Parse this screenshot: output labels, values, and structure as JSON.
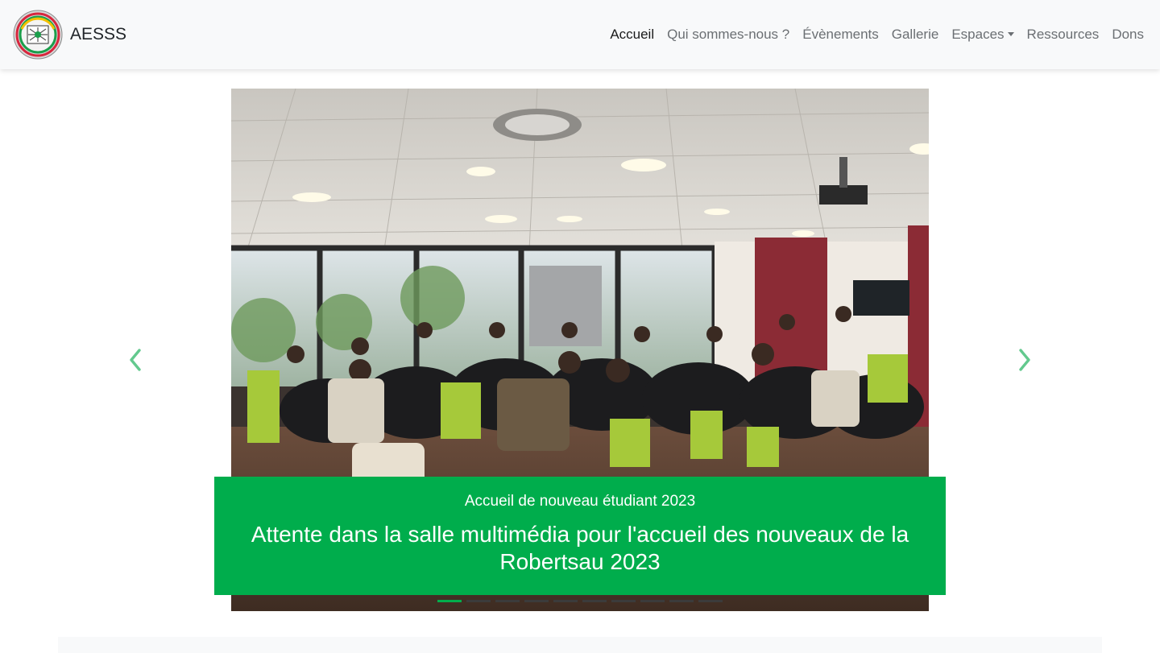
{
  "brand": {
    "name": "AESSS",
    "logo_icon": "aesss-seal-logo"
  },
  "nav": {
    "items": [
      {
        "label": "Accueil",
        "active": true
      },
      {
        "label": "Qui sommes-nous ?"
      },
      {
        "label": "Évènements"
      },
      {
        "label": "Gallerie"
      },
      {
        "label": "Espaces",
        "dropdown": true
      },
      {
        "label": "Ressources"
      },
      {
        "label": "Dons"
      }
    ]
  },
  "carousel": {
    "subtitle": "Accueil de nouveau étudiant 2023",
    "title": "Attente dans la salle multimédia pour l'accueil des nouveaux de la Robertsau 2023",
    "slide_count": 10,
    "active_index": 0,
    "prev_icon": "chevron-left-icon",
    "next_icon": "chevron-right-icon",
    "accent_color": "#00ad4c",
    "control_color": "#63c98e"
  }
}
